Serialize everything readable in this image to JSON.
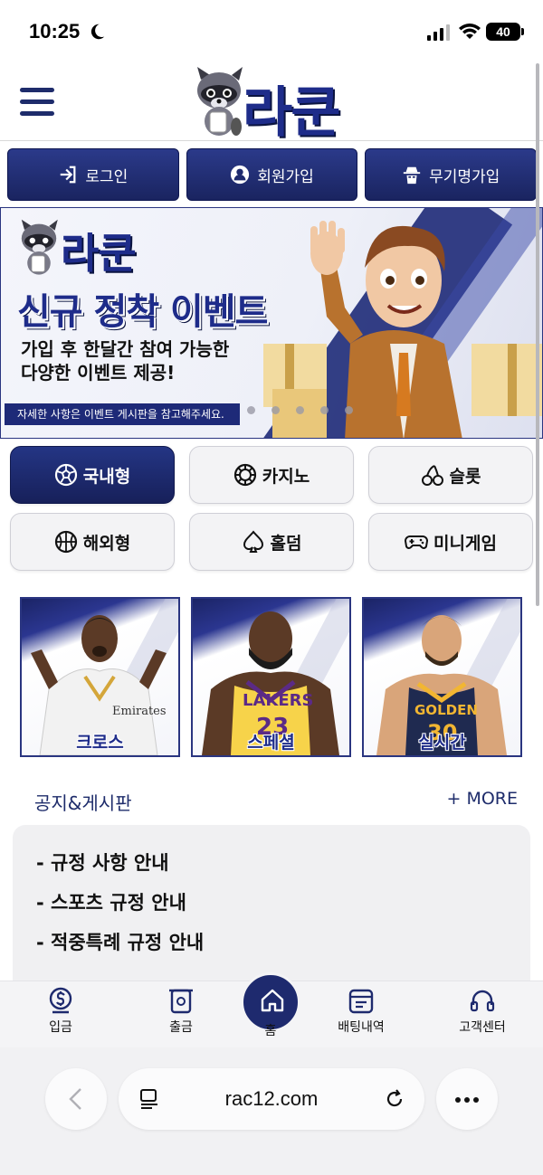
{
  "status": {
    "time": "10:25",
    "battery": "40"
  },
  "header": {
    "logo_text": "라쿤"
  },
  "auth": {
    "login": "로그인",
    "signup": "회원가입",
    "anon_signup": "무기명가입"
  },
  "banner": {
    "logo_text": "라쿤",
    "title": "신규 정착 이벤트",
    "sub1": "가입 후 한달간 참여 가능한",
    "sub2": "다양한 이벤트 제공!",
    "note": "자세한 사항은 이벤트 게시판을 참고해주세요."
  },
  "categories": [
    {
      "label": "국내형",
      "icon": "soccer-ball-icon"
    },
    {
      "label": "카지노",
      "icon": "casino-chip-icon"
    },
    {
      "label": "슬롯",
      "icon": "cherry-icon"
    },
    {
      "label": "해외형",
      "icon": "basketball-icon"
    },
    {
      "label": "홀덤",
      "icon": "spade-icon"
    },
    {
      "label": "미니게임",
      "icon": "gamepad-icon"
    }
  ],
  "cards": [
    {
      "label": "크로스"
    },
    {
      "label": "스페셜"
    },
    {
      "label": "실시간"
    }
  ],
  "notice": {
    "title": "공지&게시판",
    "more": "+ MORE",
    "items": [
      "- 규정 사항 안내",
      "- 스포츠 규정 안내",
      "- 적중특례 규정 안내"
    ]
  },
  "bottom_nav": {
    "deposit": "입금",
    "withdraw": "출금",
    "home": "홈",
    "bet_history": "배팅내역",
    "support": "고객센터"
  },
  "browser": {
    "url": "rac12.com"
  },
  "colors": {
    "brand_navy": "#1e2a6e",
    "brand_blue": "#1e2c8a"
  }
}
